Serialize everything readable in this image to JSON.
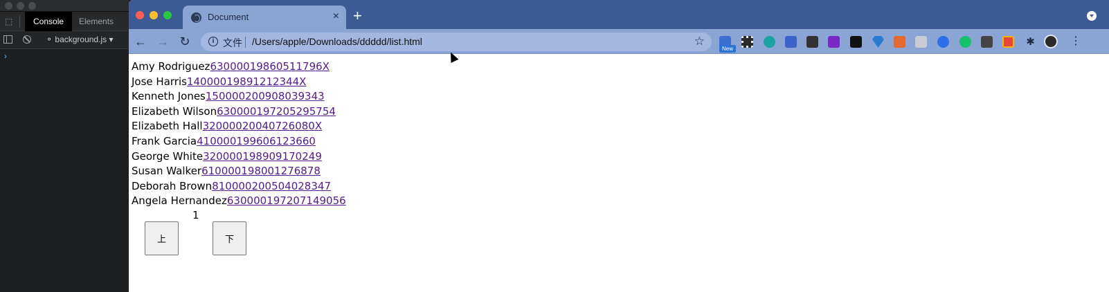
{
  "devtools": {
    "tabs": [
      "Console",
      "Elements"
    ],
    "active_tab": "Console",
    "context": "background.js",
    "prompt": "›"
  },
  "browser": {
    "tab_title": "Document",
    "tab_close": "×",
    "new_tab": "+",
    "nav": {
      "back": "←",
      "forward": "→",
      "reload": "↻"
    },
    "omnibox": {
      "info": "i",
      "scheme_label": "文件",
      "url": "/Users/apple/Downloads/ddddd/list.html",
      "star": "☆"
    },
    "extension_badge": "New",
    "menu": "⋮"
  },
  "list": [
    {
      "name": "Amy Rodriguez",
      "id": "63000019860511796X"
    },
    {
      "name": "Jose Harris",
      "id": "14000019891212344X"
    },
    {
      "name": "Kenneth Jones",
      "id": "150000200908039343"
    },
    {
      "name": "Elizabeth Wilson",
      "id": "630000197205295754"
    },
    {
      "name": "Elizabeth Hall",
      "id": "32000020040726080X"
    },
    {
      "name": "Frank Garcia",
      "id": "410000199606123660"
    },
    {
      "name": "George White",
      "id": "320000198909170249"
    },
    {
      "name": "Susan Walker",
      "id": "610000198001276878"
    },
    {
      "name": "Deborah Brown",
      "id": "810000200504028347"
    },
    {
      "name": "Angela Hernandez",
      "id": "630000197207149056"
    }
  ],
  "pager": {
    "current": "1",
    "prev_label": "上",
    "next_label": "下"
  },
  "colors": {
    "tabstrip": "#3c5a94",
    "toolbar": "#8aa4d4",
    "link": "#551a8b"
  }
}
